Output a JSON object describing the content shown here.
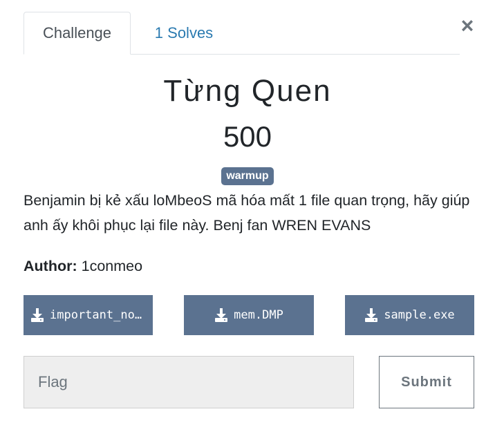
{
  "tabs": [
    {
      "label": "Challenge",
      "active": true
    },
    {
      "label": "1 Solves",
      "active": false
    }
  ],
  "close_label": "×",
  "challenge": {
    "name": "Từng Quen",
    "value": "500",
    "tag": "warmup",
    "description": "Benjamin bị kẻ xấu loMbeoS mã hóa mất 1 file quan trọng, hãy giúp anh ấy khôi phục lại file này. Benj fan WREN EVANS",
    "author_label": "Author:",
    "author": "1conmeo"
  },
  "files": [
    {
      "label": "important_no...",
      "icon": "download-icon"
    },
    {
      "label": "mem.DMP",
      "icon": "download-icon"
    },
    {
      "label": "sample.exe",
      "icon": "download-icon"
    }
  ],
  "flag_form": {
    "placeholder": "Flag",
    "value": "",
    "submit_label": "Submit"
  },
  "colors": {
    "accent": "#5b7290",
    "link": "#2a7ab0",
    "input_bg": "#eeeeee"
  }
}
